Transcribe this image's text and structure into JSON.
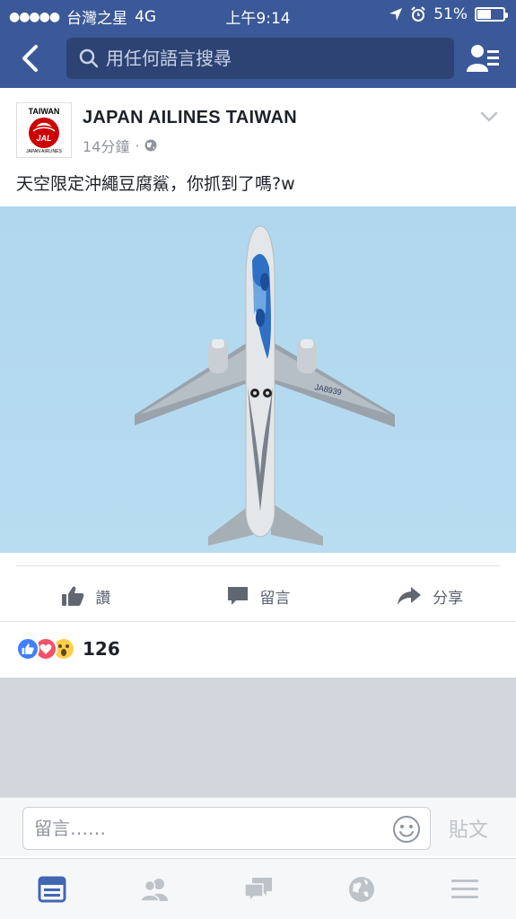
{
  "status": {
    "carrier": "台灣之星",
    "network": "4G",
    "time": "上午9:14",
    "battery_pct": "51%",
    "battery_level": 0.51
  },
  "nav": {
    "search_placeholder": "用任何語言搜尋"
  },
  "post": {
    "author": "JAPAN AILINES TAIWAN",
    "logo_top": "TAIWAN",
    "logo_brand": "JAL",
    "logo_bottom": "JAPAN AIRLINES",
    "time": "14分鐘",
    "separator": "·",
    "text": "天空限定沖繩豆腐鯊，你抓到了嗎?w",
    "aircraft_registration": "JA8939",
    "actions": {
      "like": "讚",
      "comment": "留言",
      "share": "分享"
    },
    "reaction_count": "126"
  },
  "composer": {
    "placeholder": "留言……",
    "post_label": "貼文"
  },
  "colors": {
    "brand": "#3b5998",
    "search_bg": "#2d4373",
    "active_tab": "#4267b2",
    "inactive_tab": "#bec3c9",
    "sky": "#b3d9ee"
  },
  "tabs": [
    "news-feed-icon",
    "friends-icon",
    "messages-icon",
    "notifications-globe-icon",
    "menu-icon"
  ]
}
